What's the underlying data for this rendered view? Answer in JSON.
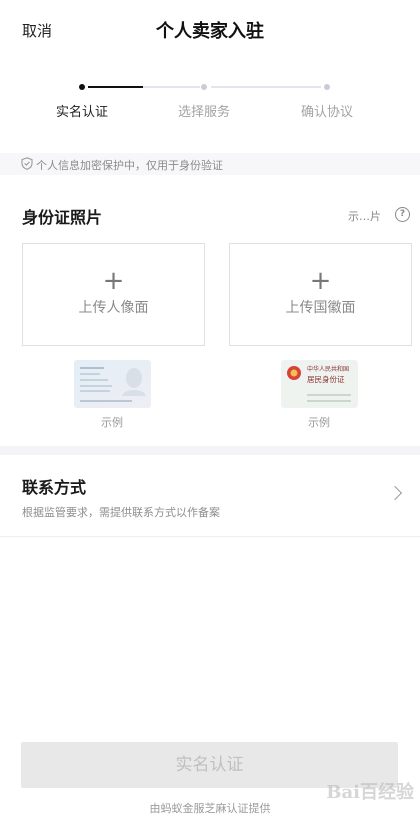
{
  "header": {
    "cancel_label": "取消",
    "title": "个人卖家入驻"
  },
  "stepper": {
    "steps": [
      {
        "label": "实名认证",
        "active": true
      },
      {
        "label": "选择服务",
        "active": false
      },
      {
        "label": "确认协议",
        "active": false
      }
    ],
    "active_color": "#111111",
    "inactive_color": "#c9ccd6"
  },
  "notice": {
    "icon": "shield-icon",
    "text": "个人信息加密保护中，仅用于身份验证"
  },
  "id_photo": {
    "title": "身份证照片",
    "sample_hint": "示…片",
    "help_icon": "question-circle-icon",
    "help_glyph": "?",
    "uploads": [
      {
        "label": "上传人像面",
        "example_label": "示例"
      },
      {
        "label": "上传国徽面",
        "example_label": "示例"
      }
    ],
    "back_card_text": [
      "中华人民共和国",
      "居民身份证"
    ]
  },
  "contact": {
    "title": "联系方式",
    "subtitle": "根据监管要求，需提供联系方式以作备案"
  },
  "submit": {
    "label": "实名认证",
    "enabled": false
  },
  "footer": {
    "provider_text": "由蚂蚁金服芝麻认证提供"
  },
  "watermark": {
    "text": "Bai百经验"
  }
}
